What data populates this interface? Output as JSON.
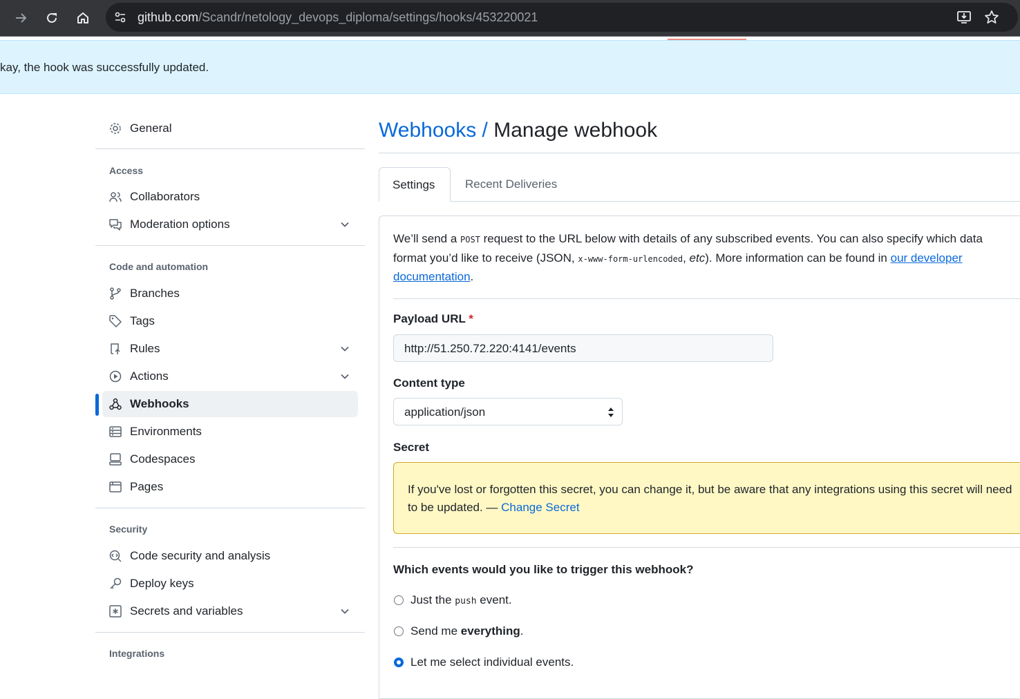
{
  "browser": {
    "url_host": "github.com",
    "url_path": "/Scandr/netology_devops_diploma/settings/hooks/453220021"
  },
  "flash": {
    "message": "kay, the hook was successfully updated."
  },
  "sidebar": {
    "general": "General",
    "sections": {
      "access": "Access",
      "code_automation": "Code and automation",
      "security": "Security",
      "integrations": "Integrations"
    },
    "items": [
      {
        "label": "Collaborators",
        "icon": "people-icon"
      },
      {
        "label": "Moderation options",
        "icon": "comment-discussion-icon"
      },
      {
        "label": "Branches",
        "icon": "git-branch-icon"
      },
      {
        "label": "Tags",
        "icon": "tag-icon"
      },
      {
        "label": "Rules",
        "icon": "repo-push-icon"
      },
      {
        "label": "Actions",
        "icon": "play-icon"
      },
      {
        "label": "Webhooks",
        "icon": "webhook-icon"
      },
      {
        "label": "Environments",
        "icon": "server-icon"
      },
      {
        "label": "Codespaces",
        "icon": "codespaces-icon"
      },
      {
        "label": "Pages",
        "icon": "browser-icon"
      },
      {
        "label": "Code security and analysis",
        "icon": "codescan-icon"
      },
      {
        "label": "Deploy keys",
        "icon": "key-icon"
      },
      {
        "label": "Secrets and variables",
        "icon": "key-asterisk-icon"
      }
    ]
  },
  "main": {
    "breadcrumb": "Webhooks",
    "separator": "/",
    "title": "Manage webhook",
    "tabs": [
      {
        "label": "Settings"
      },
      {
        "label": "Recent Deliveries"
      }
    ],
    "intro": {
      "p1": "We’ll send a ",
      "code1": "POST",
      "p2": " request to the URL below with details of any subscribed events. You can also specify which data format you’d like to receive (JSON, ",
      "code2": "x-www-form-urlencoded",
      "p3": ", ",
      "em": "etc",
      "p4": "). More information can be found in ",
      "link": "our developer documentation",
      "p5": "."
    },
    "payload_url": {
      "label": "Payload URL",
      "required_mark": "*",
      "value": "http://51.250.72.220:4141/events"
    },
    "content_type": {
      "label": "Content type",
      "value": "application/json"
    },
    "secret": {
      "label": "Secret",
      "warning": "If you've lost or forgotten this secret, you can change it, but be aware that any integrations using this secret will need to be updated. — ",
      "link": "Change Secret"
    },
    "events": {
      "question": "Which events would you like to trigger this webhook?",
      "options": [
        {
          "pre": "Just the ",
          "code": "push",
          "post": " event.",
          "selected": false
        },
        {
          "pre": "Send me ",
          "bold": "everything",
          "post": ".",
          "selected": false
        },
        {
          "pre": "Let me select individual events.",
          "selected": true
        }
      ]
    }
  },
  "colors": {
    "accent": "#0969da",
    "flash_bg": "#ddf4ff",
    "warn_bg": "#fff8c5",
    "danger": "#d1242f"
  }
}
